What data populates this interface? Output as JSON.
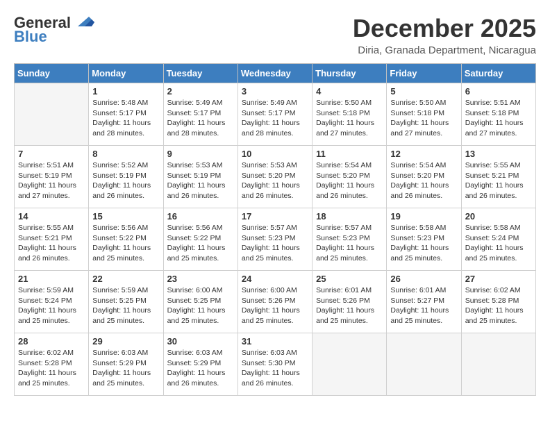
{
  "header": {
    "logo_line1": "General",
    "logo_line2": "Blue",
    "month": "December 2025",
    "location": "Diria, Granada Department, Nicaragua"
  },
  "days_of_week": [
    "Sunday",
    "Monday",
    "Tuesday",
    "Wednesday",
    "Thursday",
    "Friday",
    "Saturday"
  ],
  "weeks": [
    [
      {
        "day": "",
        "info": ""
      },
      {
        "day": "1",
        "info": "Sunrise: 5:48 AM\nSunset: 5:17 PM\nDaylight: 11 hours\nand 28 minutes."
      },
      {
        "day": "2",
        "info": "Sunrise: 5:49 AM\nSunset: 5:17 PM\nDaylight: 11 hours\nand 28 minutes."
      },
      {
        "day": "3",
        "info": "Sunrise: 5:49 AM\nSunset: 5:17 PM\nDaylight: 11 hours\nand 28 minutes."
      },
      {
        "day": "4",
        "info": "Sunrise: 5:50 AM\nSunset: 5:18 PM\nDaylight: 11 hours\nand 27 minutes."
      },
      {
        "day": "5",
        "info": "Sunrise: 5:50 AM\nSunset: 5:18 PM\nDaylight: 11 hours\nand 27 minutes."
      },
      {
        "day": "6",
        "info": "Sunrise: 5:51 AM\nSunset: 5:18 PM\nDaylight: 11 hours\nand 27 minutes."
      }
    ],
    [
      {
        "day": "7",
        "info": "Sunrise: 5:51 AM\nSunset: 5:19 PM\nDaylight: 11 hours\nand 27 minutes."
      },
      {
        "day": "8",
        "info": "Sunrise: 5:52 AM\nSunset: 5:19 PM\nDaylight: 11 hours\nand 26 minutes."
      },
      {
        "day": "9",
        "info": "Sunrise: 5:53 AM\nSunset: 5:19 PM\nDaylight: 11 hours\nand 26 minutes."
      },
      {
        "day": "10",
        "info": "Sunrise: 5:53 AM\nSunset: 5:20 PM\nDaylight: 11 hours\nand 26 minutes."
      },
      {
        "day": "11",
        "info": "Sunrise: 5:54 AM\nSunset: 5:20 PM\nDaylight: 11 hours\nand 26 minutes."
      },
      {
        "day": "12",
        "info": "Sunrise: 5:54 AM\nSunset: 5:20 PM\nDaylight: 11 hours\nand 26 minutes."
      },
      {
        "day": "13",
        "info": "Sunrise: 5:55 AM\nSunset: 5:21 PM\nDaylight: 11 hours\nand 26 minutes."
      }
    ],
    [
      {
        "day": "14",
        "info": "Sunrise: 5:55 AM\nSunset: 5:21 PM\nDaylight: 11 hours\nand 26 minutes."
      },
      {
        "day": "15",
        "info": "Sunrise: 5:56 AM\nSunset: 5:22 PM\nDaylight: 11 hours\nand 25 minutes."
      },
      {
        "day": "16",
        "info": "Sunrise: 5:56 AM\nSunset: 5:22 PM\nDaylight: 11 hours\nand 25 minutes."
      },
      {
        "day": "17",
        "info": "Sunrise: 5:57 AM\nSunset: 5:23 PM\nDaylight: 11 hours\nand 25 minutes."
      },
      {
        "day": "18",
        "info": "Sunrise: 5:57 AM\nSunset: 5:23 PM\nDaylight: 11 hours\nand 25 minutes."
      },
      {
        "day": "19",
        "info": "Sunrise: 5:58 AM\nSunset: 5:23 PM\nDaylight: 11 hours\nand 25 minutes."
      },
      {
        "day": "20",
        "info": "Sunrise: 5:58 AM\nSunset: 5:24 PM\nDaylight: 11 hours\nand 25 minutes."
      }
    ],
    [
      {
        "day": "21",
        "info": "Sunrise: 5:59 AM\nSunset: 5:24 PM\nDaylight: 11 hours\nand 25 minutes."
      },
      {
        "day": "22",
        "info": "Sunrise: 5:59 AM\nSunset: 5:25 PM\nDaylight: 11 hours\nand 25 minutes."
      },
      {
        "day": "23",
        "info": "Sunrise: 6:00 AM\nSunset: 5:25 PM\nDaylight: 11 hours\nand 25 minutes."
      },
      {
        "day": "24",
        "info": "Sunrise: 6:00 AM\nSunset: 5:26 PM\nDaylight: 11 hours\nand 25 minutes."
      },
      {
        "day": "25",
        "info": "Sunrise: 6:01 AM\nSunset: 5:26 PM\nDaylight: 11 hours\nand 25 minutes."
      },
      {
        "day": "26",
        "info": "Sunrise: 6:01 AM\nSunset: 5:27 PM\nDaylight: 11 hours\nand 25 minutes."
      },
      {
        "day": "27",
        "info": "Sunrise: 6:02 AM\nSunset: 5:28 PM\nDaylight: 11 hours\nand 25 minutes."
      }
    ],
    [
      {
        "day": "28",
        "info": "Sunrise: 6:02 AM\nSunset: 5:28 PM\nDaylight: 11 hours\nand 25 minutes."
      },
      {
        "day": "29",
        "info": "Sunrise: 6:03 AM\nSunset: 5:29 PM\nDaylight: 11 hours\nand 25 minutes."
      },
      {
        "day": "30",
        "info": "Sunrise: 6:03 AM\nSunset: 5:29 PM\nDaylight: 11 hours\nand 26 minutes."
      },
      {
        "day": "31",
        "info": "Sunrise: 6:03 AM\nSunset: 5:30 PM\nDaylight: 11 hours\nand 26 minutes."
      },
      {
        "day": "",
        "info": ""
      },
      {
        "day": "",
        "info": ""
      },
      {
        "day": "",
        "info": ""
      }
    ]
  ]
}
